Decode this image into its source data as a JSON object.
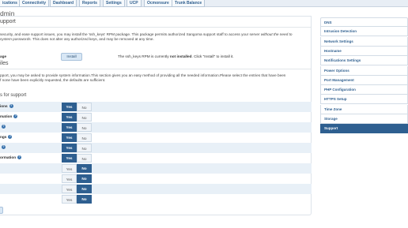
{
  "nav": {
    "tabs": [
      {
        "label": "ications"
      },
      {
        "label": "Connectivity"
      },
      {
        "label": "Dashboard"
      },
      {
        "label": "Reports"
      },
      {
        "label": "Settings"
      },
      {
        "label": "UCP"
      },
      {
        "label": "Ocmonsure"
      },
      {
        "label": "Trunk Balance"
      }
    ]
  },
  "page": {
    "title": "dmin"
  },
  "support": {
    "heading": "upport",
    "intro_line1": "security, and ease support issues, you may install the 'ssh_keys' RPM package. This package permits authorized Sangoma support staff to access your server",
    "intro_line1_em": " without the need to",
    "intro_line2_em": "system passwords.",
    "intro_line2": " This does not alter any authorized keys, and may be removed at any time.",
    "install_label": "age",
    "install_button": "Install",
    "rpm_status_pre": "The ssh_keys RPM is currently ",
    "rpm_status_bold": "not installed",
    "rpm_status_post": ". Click \"Install\" to install it."
  },
  "files": {
    "heading": "iles",
    "intro_line1": "pport, you may be asked to provide system information.This section gives you an easy method of providing all the needed information.Please select the entries that have been",
    "intro_line2": "f none have been explicitly requested, the defaults are sufficient."
  },
  "options": {
    "heading": "s for support",
    "yes_label": "Yes",
    "no_label": "No",
    "help_glyph": "?",
    "rows": [
      {
        "label": "ions",
        "value": "Yes"
      },
      {
        "label": "mation",
        "value": "Yes"
      },
      {
        "label": "",
        "value": "Yes"
      },
      {
        "label": "ngs",
        "value": "Yes"
      },
      {
        "label": "",
        "value": "Yes"
      },
      {
        "label": "ormation",
        "value": "Yes"
      },
      {
        "label": "",
        "value": "No"
      },
      {
        "label": "",
        "value": "No"
      },
      {
        "label": "",
        "value": "No"
      },
      {
        "label": "",
        "value": "No"
      }
    ]
  },
  "sidebar": {
    "items": [
      {
        "label": "DNS"
      },
      {
        "label": "Intrusion Detection"
      },
      {
        "label": "Network Settings"
      },
      {
        "label": "Hostname"
      },
      {
        "label": "Notifications Settings"
      },
      {
        "label": "Power Options"
      },
      {
        "label": "Port Management"
      },
      {
        "label": "PHP Configuration"
      },
      {
        "label": "HTTPS Setup"
      },
      {
        "label": "Time Zone"
      },
      {
        "label": "Storage"
      },
      {
        "label": "Support"
      }
    ],
    "active": "Support"
  }
}
